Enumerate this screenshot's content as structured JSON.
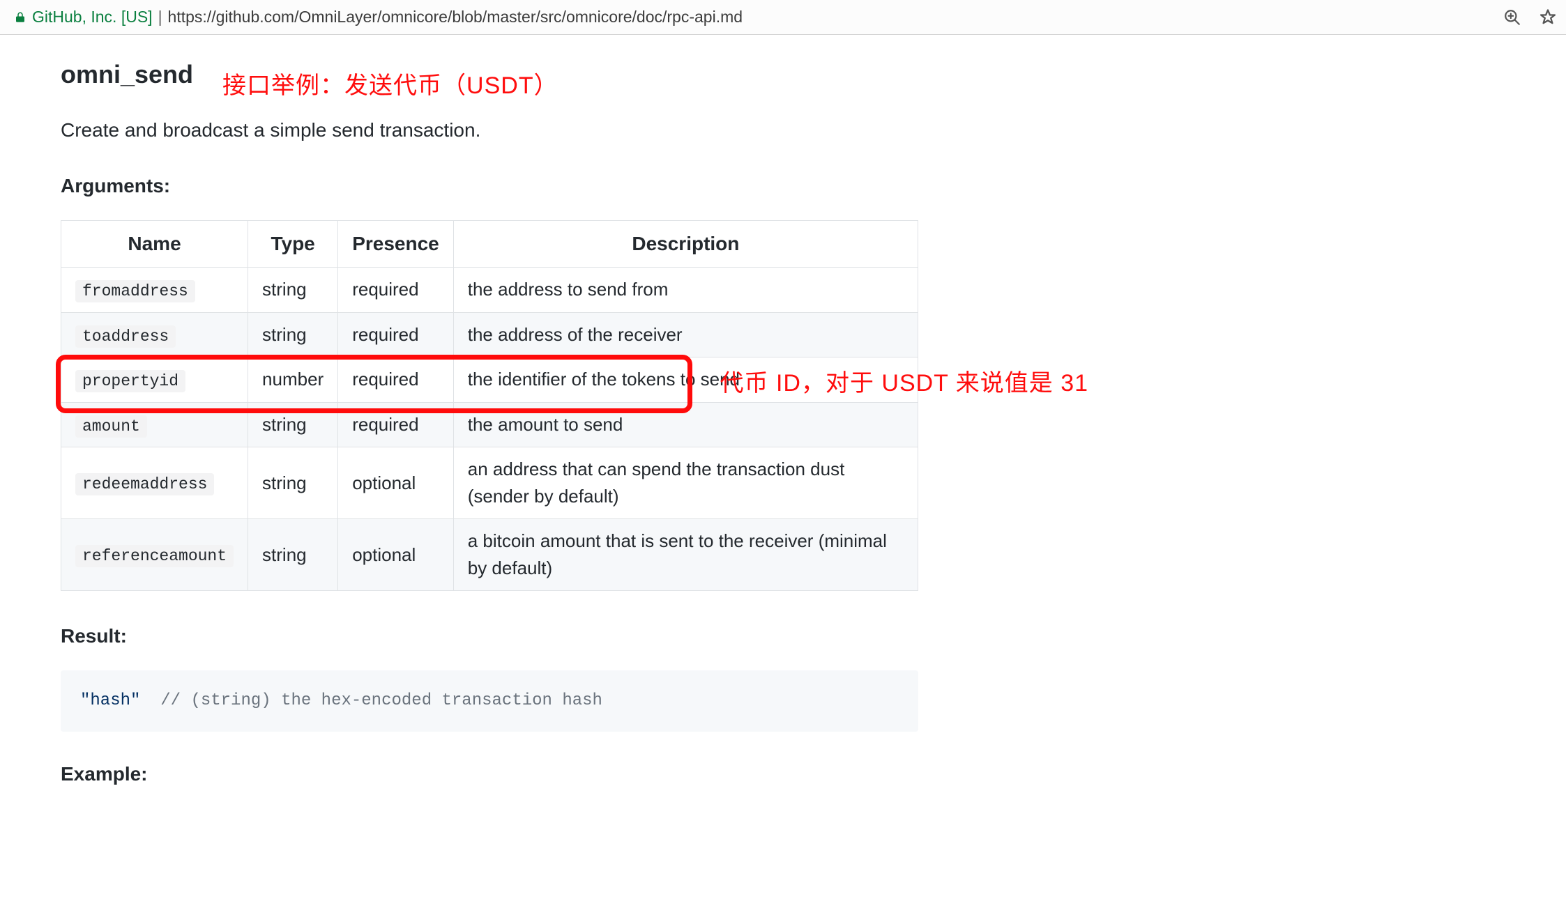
{
  "browser": {
    "site_identity": "GitHub, Inc. [US]",
    "url": "https://github.com/OmniLayer/omnicore/blob/master/src/omnicore/doc/rpc-api.md"
  },
  "header": {
    "api_name": "omni_send",
    "annotation": "接口举例：发送代币（USDT）"
  },
  "intro": "Create and broadcast a simple send transaction.",
  "sections": {
    "arguments_label": "Arguments:",
    "result_label": "Result:",
    "example_label": "Example:"
  },
  "args_table": {
    "columns": [
      "Name",
      "Type",
      "Presence",
      "Description"
    ],
    "rows": [
      {
        "name": "fromaddress",
        "type": "string",
        "presence": "required",
        "desc": "the address to send from"
      },
      {
        "name": "toaddress",
        "type": "string",
        "presence": "required",
        "desc": "the address of the receiver"
      },
      {
        "name": "propertyid",
        "type": "number",
        "presence": "required",
        "desc": "the identifier of the tokens to send"
      },
      {
        "name": "amount",
        "type": "string",
        "presence": "required",
        "desc": "the amount to send"
      },
      {
        "name": "redeemaddress",
        "type": "string",
        "presence": "optional",
        "desc": "an address that can spend the transaction dust (sender by default)"
      },
      {
        "name": "referenceamount",
        "type": "string",
        "presence": "optional",
        "desc": "a bitcoin amount that is sent to the receiver (minimal by default)"
      }
    ]
  },
  "highlight": {
    "row_index": 2,
    "note": "代币 ID，对于 USDT 来说值是 31"
  },
  "result_block": {
    "literal": "\"hash\"",
    "comment": "// (string) the hex-encoded transaction hash"
  }
}
